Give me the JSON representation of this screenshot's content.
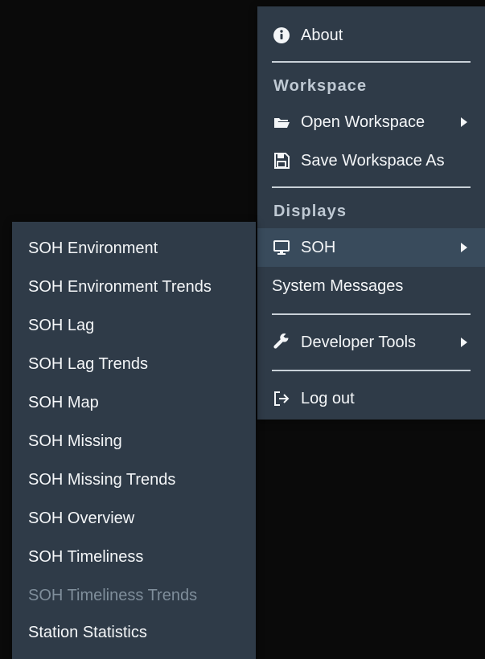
{
  "main_menu": {
    "about_label": "About",
    "workspace_header": "Workspace",
    "open_workspace_label": "Open Workspace",
    "save_workspace_label": "Save Workspace As",
    "displays_header": "Displays",
    "soh_label": "SOH",
    "system_messages_label": "System Messages",
    "developer_tools_label": "Developer Tools",
    "logout_label": "Log out"
  },
  "soh_submenu": {
    "items": [
      {
        "label": "SOH Environment",
        "disabled": false
      },
      {
        "label": "SOH Environment Trends",
        "disabled": false
      },
      {
        "label": "SOH Lag",
        "disabled": false
      },
      {
        "label": "SOH Lag Trends",
        "disabled": false
      },
      {
        "label": "SOH Map",
        "disabled": false
      },
      {
        "label": "SOH Missing",
        "disabled": false
      },
      {
        "label": "SOH Missing Trends",
        "disabled": false
      },
      {
        "label": "SOH Overview",
        "disabled": false
      },
      {
        "label": "SOH Timeliness",
        "disabled": false
      },
      {
        "label": "SOH Timeliness Trends",
        "disabled": true
      },
      {
        "label": "Station Statistics",
        "disabled": false
      }
    ]
  },
  "icons": {
    "about": "info-circle-icon",
    "open_workspace": "folder-open-icon",
    "save_workspace": "save-icon",
    "soh": "monitor-icon",
    "developer_tools": "wrench-icon",
    "logout": "log-out-icon",
    "submenu_arrow": "chevron-right-icon"
  },
  "colors": {
    "background": "#0a0a0a",
    "menu_background": "#2f3b48",
    "active_background": "#394b5c",
    "text": "#f4f6f8",
    "section_header_text": "#bfc9d3",
    "disabled_text": "#7f8e9b",
    "divider": "#c9d1d8"
  }
}
